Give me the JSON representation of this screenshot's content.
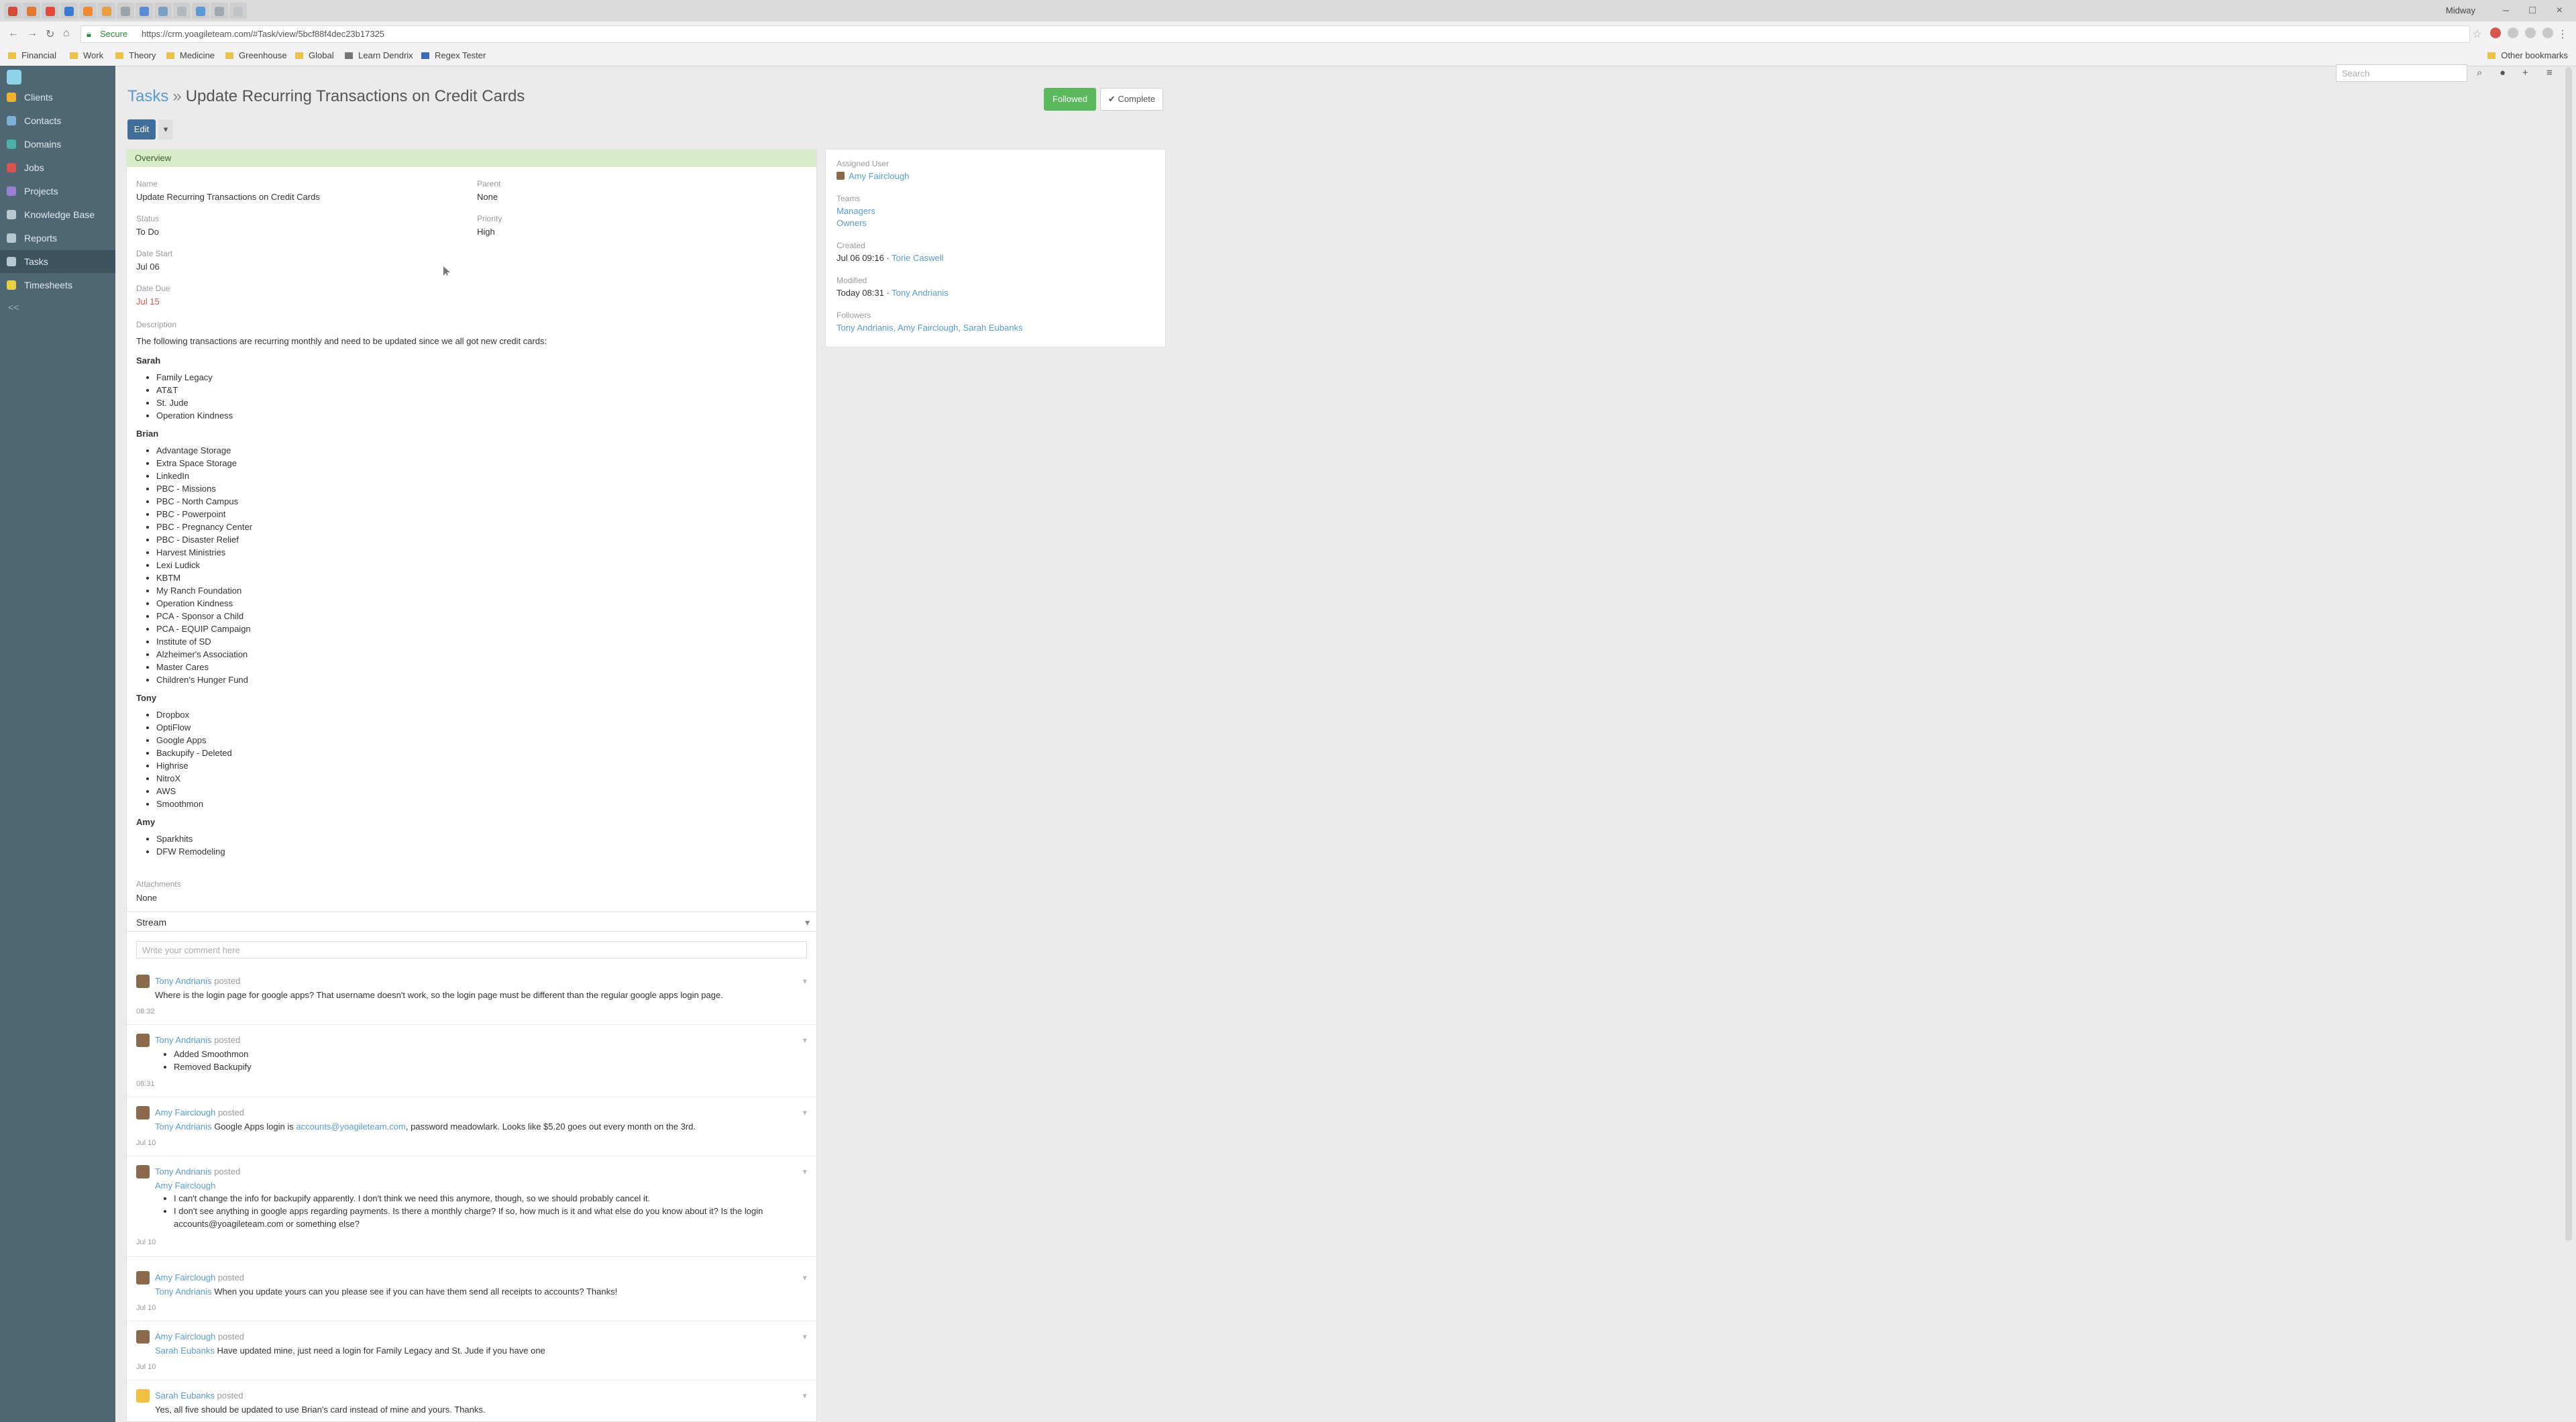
{
  "browser": {
    "user_name": "Midway",
    "secure_label": "Secure",
    "url": "https://crm.yoagileteam.com/#Task/view/5bcf88f4dec23b17325",
    "bookmarks": [
      "Financial",
      "Work",
      "Theory",
      "Medicine",
      "Greenhouse",
      "Global",
      "Learn Dendrix",
      "Regex Tester"
    ],
    "other_bookmarks": "Other bookmarks"
  },
  "sidebar": {
    "items": [
      {
        "label": "Clients",
        "color": "#f0b030"
      },
      {
        "label": "Contacts",
        "color": "#7bb0d8"
      },
      {
        "label": "Domains",
        "color": "#4ab0a8"
      },
      {
        "label": "Jobs",
        "color": "#d9534f"
      },
      {
        "label": "Projects",
        "color": "#9b7fd0"
      },
      {
        "label": "Knowledge Base",
        "color": "#b8c8d0"
      },
      {
        "label": "Reports",
        "color": "#b8c8d0"
      },
      {
        "label": "Tasks",
        "color": "#b8c8d0"
      },
      {
        "label": "Timesheets",
        "color": "#e8d040"
      }
    ],
    "collapse": "<<"
  },
  "topbar": {
    "search_placeholder": "Search"
  },
  "header": {
    "breadcrumb_root": "Tasks",
    "separator": "»",
    "title": "Update Recurring Transactions on Credit Cards",
    "edit_label": "Edit",
    "more_label": "▾",
    "followed_label": "Followed",
    "complete_label": "✔ Complete"
  },
  "overview": {
    "header": "Overview",
    "name_label": "Name",
    "name_value": "Update Recurring Transactions on Credit Cards",
    "parent_label": "Parent",
    "parent_value": "None",
    "status_label": "Status",
    "status_value": "To Do",
    "priority_label": "Priority",
    "priority_value": "High",
    "date_start_label": "Date Start",
    "date_start_value": "Jul 06",
    "date_due_label": "Date Due",
    "date_due_value": "Jul 15",
    "description_label": "Description",
    "description_intro": "The following transactions are recurring monthly and need to be updated since we all got new credit cards:",
    "groups": [
      {
        "name": "Sarah",
        "items": [
          "Family Legacy",
          "AT&T",
          "St. Jude",
          "Operation Kindness"
        ]
      },
      {
        "name": "Brian",
        "items": [
          "Advantage Storage",
          "Extra Space Storage",
          "LinkedIn",
          "PBC - Missions",
          "PBC - North Campus",
          "PBC - Powerpoint",
          "PBC - Pregnancy Center",
          "PBC - Disaster Relief",
          "Harvest Ministries",
          "Lexi Ludick",
          "KBTM",
          "My Ranch Foundation",
          "Operation Kindness",
          "PCA - Sponsor a Child",
          "PCA - EQUIP Campaign",
          "Institute of SD",
          "Alzheimer's Association",
          "Master Cares",
          "Children's Hunger Fund"
        ]
      },
      {
        "name": "Tony",
        "items": [
          "Dropbox",
          "OptiFlow",
          "Google Apps",
          "Backupify - Deleted",
          "Highrise",
          "NitroX",
          "AWS",
          "Smoothmon"
        ]
      },
      {
        "name": "Amy",
        "items": [
          "Sparkhits",
          "DFW Remodeling"
        ]
      }
    ],
    "attachments_label": "Attachments",
    "attachments_value": "None"
  },
  "stream": {
    "title": "Stream",
    "comment_placeholder": "Write your comment here",
    "posts": [
      {
        "author": "Tony Andrianis",
        "verb": "posted",
        "text": "Where is the login page for google apps? That username doesn't work, so the login page must be different than the regular google apps login page.",
        "date": "08:32"
      },
      {
        "author": "Tony Andrianis",
        "verb": "posted",
        "list": [
          "Added Smoothmon",
          "Removed Backupify"
        ],
        "date": "08:31"
      },
      {
        "author": "Amy Fairclough",
        "verb": "posted",
        "mention": "Tony Andrianis",
        "text": "Google Apps login is",
        "link": "accounts@yoagileteam.com",
        "text2": ", password meadowlark. Looks like $5.20 goes out every month on the 3rd.",
        "date": "Jul 10"
      },
      {
        "author": "Tony Andrianis",
        "verb": "posted",
        "mention": "Amy Fairclough",
        "list": [
          "I can't change the info for backupify apparently. I don't think we need this anymore, though, so we should probably cancel it.",
          "I don't see anything in google apps regarding payments. Is there a monthly charge? If so, how much is it and what else do you know about it? Is the login accounts@yoagileteam.com or something else?"
        ],
        "date": "Jul 10"
      },
      {
        "author": "Amy Fairclough",
        "verb": "posted",
        "mention": "Tony Andrianis",
        "text": "When you update yours can you please see if you can have them send all receipts to accounts? Thanks!",
        "date": "Jul 10"
      },
      {
        "author": "Amy Fairclough",
        "verb": "posted",
        "mention": "Sarah Eubanks",
        "text": "Have updated mine, just need a login for Family Legacy and St. Jude if you have one",
        "date": "Jul 10"
      },
      {
        "author": "Sarah Eubanks",
        "verb": "posted",
        "text": "Yes, all five should be updated to use Brian's card instead of mine and yours. Thanks."
      }
    ]
  },
  "side_panel": {
    "assigned_label": "Assigned User",
    "assigned_value": "Amy Fairclough",
    "teams_label": "Teams",
    "teams": [
      "Managers",
      "Owners"
    ],
    "created_label": "Created",
    "created_date": "Jul 06 09:16",
    "created_by": "Torie Caswell",
    "modified_label": "Modified",
    "modified_date": "Today 08:31",
    "modified_by": "Tony Andrianis",
    "followers_label": "Followers",
    "followers_value": "Tony Andrianis, Amy Fairclough, Sarah Eubanks"
  }
}
